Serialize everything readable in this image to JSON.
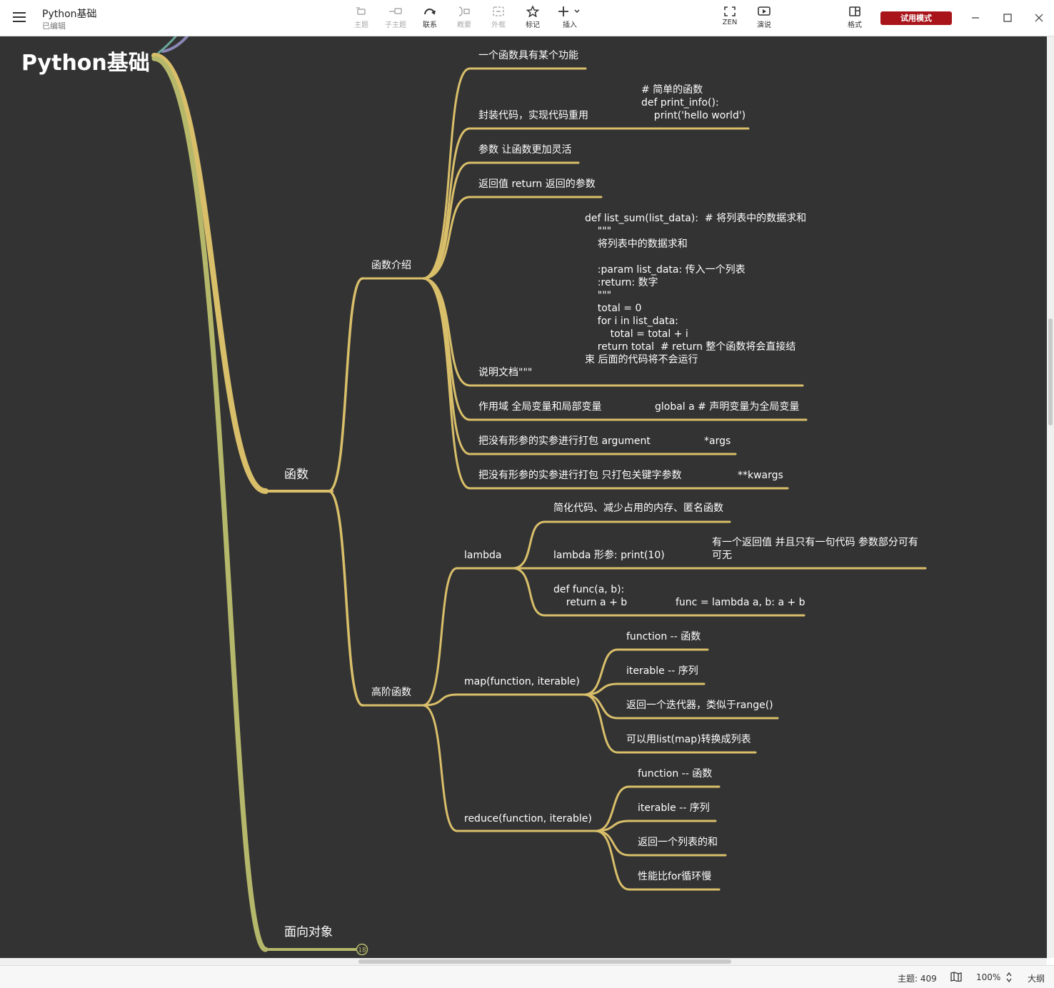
{
  "app": {
    "doc_title": "Python基础",
    "doc_status": "已编辑"
  },
  "toolbar": {
    "items": [
      {
        "label": "主题",
        "icon": "topic-icon",
        "enabled": false
      },
      {
        "label": "子主题",
        "icon": "subtopic-icon",
        "enabled": false
      },
      {
        "label": "联系",
        "icon": "relationship-icon",
        "enabled": true
      },
      {
        "label": "概要",
        "icon": "summary-icon",
        "enabled": false
      },
      {
        "label": "外框",
        "icon": "boundary-icon",
        "enabled": false
      },
      {
        "label": "标记",
        "icon": "star-icon",
        "enabled": true
      },
      {
        "label": "插入",
        "icon": "plus-icon",
        "enabled": true
      }
    ],
    "zen_label": "ZEN",
    "present_label": "演说",
    "format_label": "格式",
    "trial_label": "试用模式"
  },
  "mindmap": {
    "root": "Python基础",
    "branch_functions": "函数",
    "branch_oop": "面向对象",
    "oop_collapsed_count": "18",
    "func_intro": "函数介绍",
    "higher_order": "高阶函数",
    "intro_items": [
      "一个函数具有某个功能",
      "封装代码，实现代码重用",
      "参数 让函数更加灵活",
      "返回值 return 返回的参数",
      "说明文档\"\"\"",
      "作用域 全局变量和局部变量",
      "把没有形参的实参进行打包  argument",
      "把没有形参的实参进行打包  只打包关键字参数"
    ],
    "intro_details": [
      "# 简单的函数\ndef print_info():\n    print('hello world')",
      "def list_sum(list_data):  # 将列表中的数据求和\n    \"\"\"\n    将列表中的数据求和\n\n    :param list_data: 传入一个列表\n    :return: 数字\n    \"\"\"\n    total = 0\n    for i in list_data:\n        total = total + i\n    return total  # return 整个函数将会直接结\n束 后面的代码将不会运行",
      "global a  # 声明变量为全局变量",
      "*args",
      "**kwargs"
    ],
    "lambda": "lambda",
    "lambda_items": [
      "简化代码、减少占用的内存、匿名函数",
      "lambda 形参: print(10)",
      "def func(a, b):\n    return a + b"
    ],
    "lambda_details": [
      "有一个返回值 并且只有一句代码 参数部分可有\n可无",
      "func = lambda a, b: a + b"
    ],
    "map": "map(function, iterable)",
    "map_items": [
      "function -- 函数",
      "iterable -- 序列",
      "返回一个迭代器，类似于range()",
      "可以用list(map)转换成列表"
    ],
    "reduce": "reduce(function, iterable)",
    "reduce_items": [
      "function -- 函数",
      "iterable -- 序列",
      "返回一个列表的和",
      "性能比for循环慢"
    ]
  },
  "status": {
    "topics": "主题: 409",
    "zoom": "100%",
    "outline": "大纲"
  },
  "colors": {
    "canvas": "#333333",
    "branch_gold": "#d9bf6a",
    "branch_green": "#b5b86a",
    "trial_red": "#a8141a"
  }
}
